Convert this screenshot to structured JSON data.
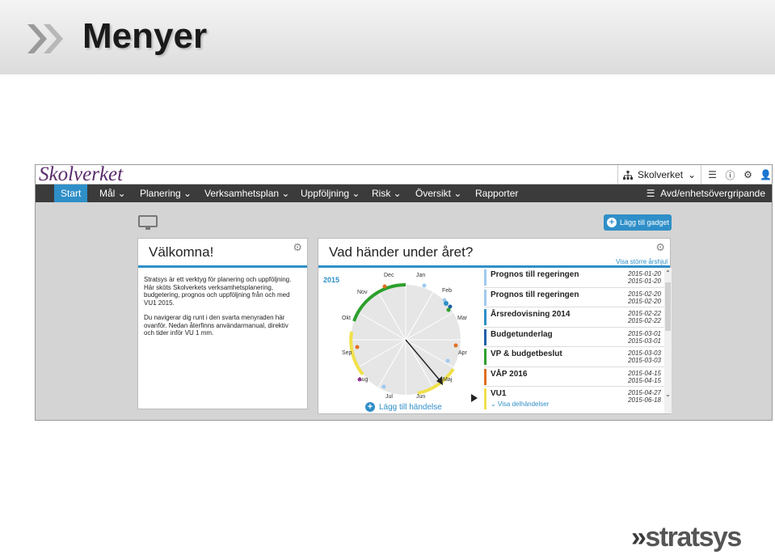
{
  "slide": {
    "title": "Menyer"
  },
  "app": {
    "logo": "Skolverket",
    "org_switch": "Skolverket",
    "nav": [
      {
        "label": "Start",
        "active": true
      },
      {
        "label": "Mål ⌄"
      },
      {
        "label": "Planering ⌄"
      },
      {
        "label": "Verksamhetsplan ⌄"
      },
      {
        "label": "Uppföljning ⌄"
      },
      {
        "label": "Risk ⌄"
      },
      {
        "label": "Översikt ⌄"
      },
      {
        "label": "Rapporter"
      }
    ],
    "nav_right": "Avd/enhetsövergripande",
    "add_gadget": "Lägg till gadget",
    "top_icons": [
      "hierarchy-icon",
      "list-icon",
      "info-icon",
      "cogs-icon",
      "user-icon"
    ],
    "accent": "#2f8fc8"
  },
  "welcome": {
    "title": "Välkomna!",
    "p1": "Stratsys är ett verktyg för planering och uppföljning. Här sköts Skolverkets verksamhetsplanering, budgetering, prognos och uppföljning från och med VU1 2015.",
    "p2": "Du navigerar dig runt i den svarta menyraden här ovanför. Nedan återfinns användarmanual, direktiv och tider inför VU 1 mm."
  },
  "year_panel": {
    "title": "Vad händer under året?",
    "link": "Visa större årshjul",
    "year": "2015",
    "months": [
      "Jan",
      "Feb",
      "Mar",
      "Apr",
      "Maj",
      "Jun",
      "Jul",
      "Aug",
      "Sep",
      "Okt",
      "Nov",
      "Dec"
    ],
    "add_event": "Lägg till händelse",
    "events": [
      {
        "title": "Prognos till regeringen",
        "d1": "2015-01-20",
        "d2": "2015-01-20",
        "color": "#9fc9ee"
      },
      {
        "title": "Prognos till regeringen",
        "d1": "2015-02-20",
        "d2": "2015-02-20",
        "color": "#9fc9ee"
      },
      {
        "title": "Årsredovisning 2014",
        "d1": "2015-02-22",
        "d2": "2015-02-22",
        "color": "#2f8fc8"
      },
      {
        "title": "Budgetunderlag",
        "d1": "2015-03-01",
        "d2": "2015-03-01",
        "color": "#1f5fa8"
      },
      {
        "title": "VP & budgetbeslut",
        "d1": "2015-03-03",
        "d2": "2015-03-03",
        "color": "#2ca02c"
      },
      {
        "title": "VÅP 2016",
        "d1": "2015-04-15",
        "d2": "2015-04-15",
        "color": "#e07020"
      },
      {
        "title": "VU1",
        "d1": "2015-04-27",
        "d2": "2015-06-18",
        "color": "#f0e04a",
        "sub": "⌄ Visa delhändelser"
      }
    ]
  },
  "footer": {
    "brand": "stratsys"
  }
}
